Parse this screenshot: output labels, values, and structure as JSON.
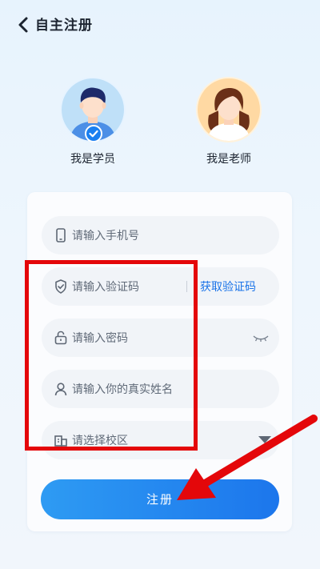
{
  "header": {
    "back_icon": "chevron-left-icon",
    "title": "自主注册"
  },
  "roles": {
    "student": {
      "label": "我是学员",
      "selected": true
    },
    "teacher": {
      "label": "我是老师",
      "selected": false
    }
  },
  "form": {
    "phone_placeholder": "请输入手机号",
    "code_placeholder": "请输入验证码",
    "get_code_label": "获取验证码",
    "password_placeholder": "请输入密码",
    "name_placeholder": "请输入你的真实姓名",
    "campus_placeholder": "请选择校区",
    "submit_label": "注册"
  },
  "colors": {
    "accent": "#1a73e8",
    "annotation": "#e4070a",
    "button_start": "#2e9bf3",
    "button_end": "#1c76ec"
  }
}
